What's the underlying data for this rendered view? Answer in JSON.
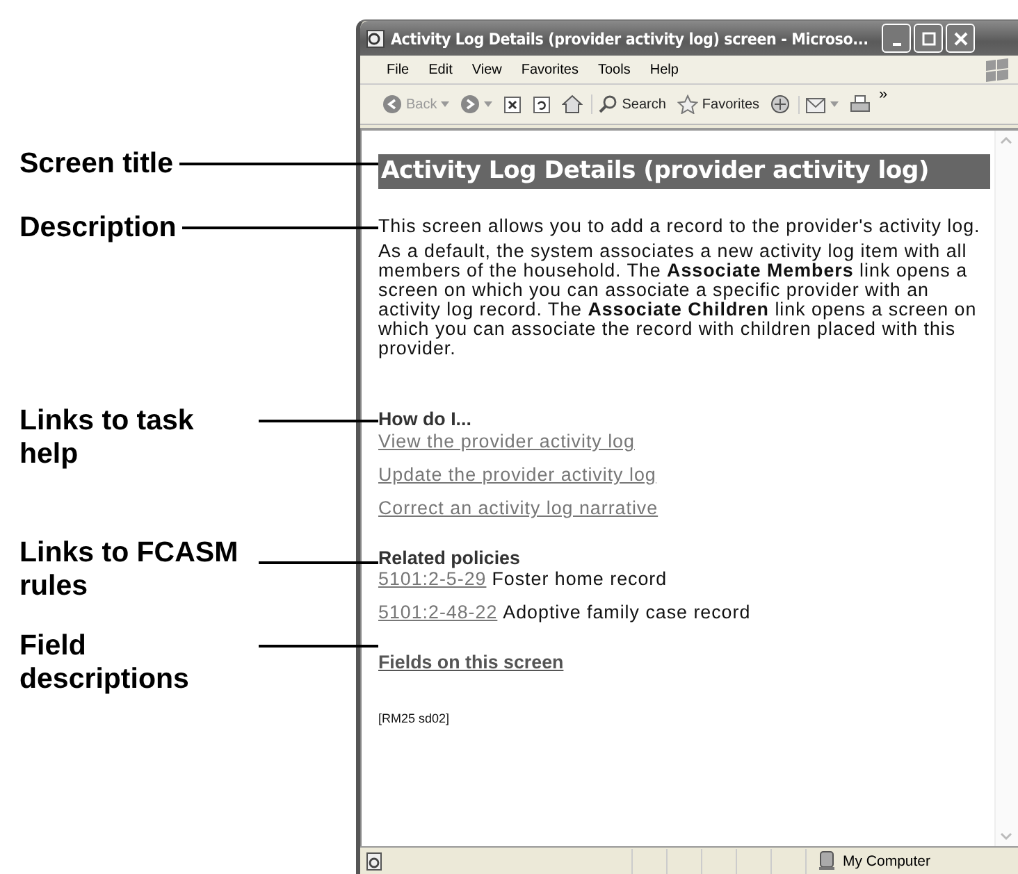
{
  "callouts": [
    {
      "label": "Screen title"
    },
    {
      "label": "Description"
    },
    {
      "label": "Links to task help"
    },
    {
      "label": "Links to FCASM rules"
    },
    {
      "label": "Field descriptions"
    }
  ],
  "window": {
    "title": "Activity Log Details (provider activity log) screen - Microso...",
    "menu": [
      "File",
      "Edit",
      "View",
      "Favorites",
      "Tools",
      "Help"
    ],
    "toolbar": [
      {
        "kind": "back",
        "label": "Back"
      },
      {
        "kind": "forward"
      },
      {
        "kind": "stop"
      },
      {
        "kind": "refresh"
      },
      {
        "kind": "home"
      },
      {
        "kind": "search",
        "label": "Search"
      },
      {
        "kind": "favorites",
        "label": "Favorites"
      },
      {
        "kind": "media"
      },
      {
        "kind": "mail"
      },
      {
        "kind": "print"
      }
    ],
    "overflow": "»"
  },
  "content": {
    "heading": "Activity Log Details (provider activity log)",
    "description": "This screen allows you to add a record to the provider's activity log.",
    "paragraph": "As a default, the system associates a new activity log item with all members of the household. The **Associate Members** link opens a screen on which you can associate a specific provider with an activity log record. The **Associate Children** link opens a screen on which you can associate the record with children placed with this provider.",
    "how_do_i": {
      "heading": "How do I...",
      "links": [
        "View the provider activity log",
        "Update the provider activity log",
        "Correct an activity log narrative"
      ]
    },
    "related_policies": {
      "heading": "Related policies",
      "items": [
        {
          "code": "5101:2-5-29",
          "text": "Foster home record"
        },
        {
          "code": "5101:2-48-22",
          "text": "Adoptive family case record"
        }
      ]
    },
    "fields_link": "Fields on this screen",
    "footer": "[RM25 sd02]"
  },
  "status_bar": {
    "zone": "My Computer"
  }
}
